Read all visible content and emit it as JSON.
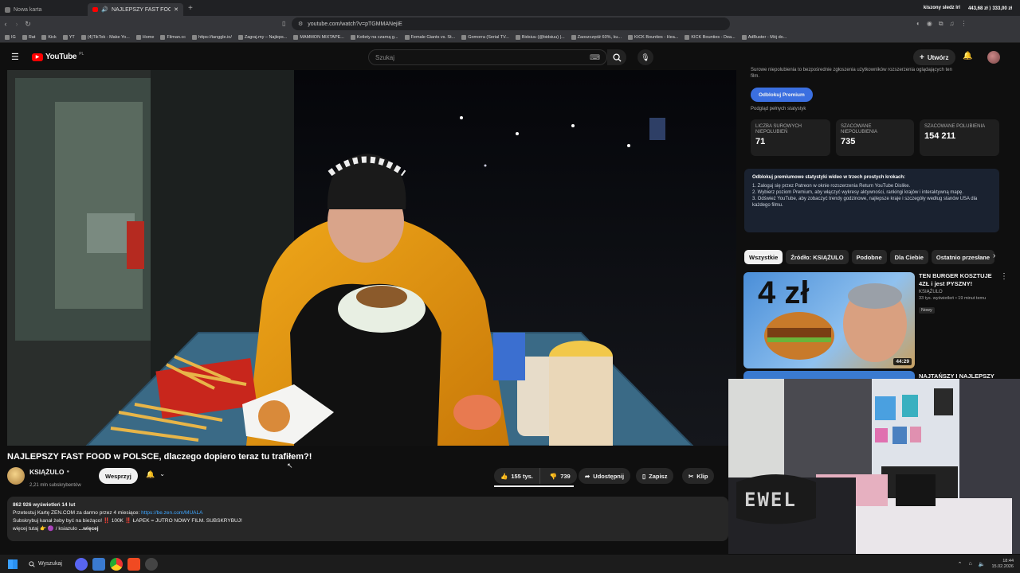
{
  "browser": {
    "tabs": [
      {
        "label": "Nowa karta",
        "active": false
      },
      {
        "label": "NAJLEPSZY FAST FOOD w PO",
        "active": true
      }
    ],
    "url": "youtube.com/watch?v=pTGMMANejiE",
    "top_right": {
      "user": "kiszony sledz lrl",
      "balance": "443,68 zł ⟩ 333,00 zł"
    },
    "bookmarks": [
      "IG",
      "Rat",
      "Kick",
      "YT",
      "(4)TikTok - Make Yo...",
      "Home",
      "Filman.cc",
      "https://tanggle.io/",
      "Zagraj.my – Najleps...",
      "MAMMON MIXTAPE...",
      "Kotlety na czarną g...",
      "Female Giants vs. St...",
      "Gomorra (Serial TV...",
      "Bidsiuu (@bidsiuu) |...",
      "Zaoszczędź 60%, ku...",
      "KICK Bounties - Hea...",
      "KICK Bounties - Dea...",
      "AdBuster - Mój do..."
    ]
  },
  "youtube": {
    "logo": "YouTube",
    "region": "PL",
    "search_placeholder": "Szukaj",
    "create_label": "Utwórz",
    "video": {
      "title": "NAJLEPSZY FAST FOOD w POLSCE, dlaczego dopiero teraz tu trafiłem?!",
      "channel": "KSIĄŻULO",
      "subscribers": "2,21 mln subskrybentów",
      "support_label": "Wesprzyj",
      "likes": "155 tys.",
      "dislikes": "739",
      "share_label": "Udostępnij",
      "save_label": "Zapisz",
      "clip_label": "Klip",
      "views_date": "862 926 wyświetleń  14 lut",
      "desc_line1_prefix": "Przetestuj Kartę ZEN.COM za darmo przez 4 miesiące: ",
      "desc_link": "https://be.zen.com/MUALA",
      "desc_line2": "Subskrybuj kanał żeby być na bieżąco! ‼️ 100K ‼️ ŁAPEK = JUTRO NOWY FILM. SUBSKRYBUJ!",
      "desc_line3": "więcej tutaj 👉 🟣 / ksiazulo",
      "more_label": "...więcej"
    },
    "rydstats": {
      "intro": "Surowe niepolubienia to bezpośrednie zgłoszenia użytkowników rozszerzenia oglądających ten film.",
      "unlock_label": "Odblokuj Premium",
      "full_stats": "Podgląd pełnych statystyk",
      "boxes": [
        {
          "label": "LICZBA SUROWYCH NIEPOLUBIEŃ",
          "value": "71"
        },
        {
          "label": "SZACOWANE NIEPOLUBIENIA",
          "value": "735"
        },
        {
          "label": "SZACOWANE POLUBIENIA",
          "value": "154 211"
        }
      ],
      "premium_title": "Odblokuj premiumowe statystyki wideo w trzech prostych krokach:",
      "steps": [
        "Zaloguj się przez Patreon w oknie rozszerzenia Return YouTube Dislike.",
        "Wybierz poziom Premium, aby włączyć wykresy aktywności, rankingi krajów i interaktywną mapę.",
        "Odśwież YouTube, aby zobaczyć trendy godzinowe, najlepsze kraje i szczegóły według stanów USA dla każdego filmu."
      ]
    },
    "chips": [
      "Wszystkie",
      "Źródło: KSIĄŻULO",
      "Podobne",
      "Dla Ciebie",
      "Ostatnio przesłane"
    ],
    "recommended": [
      {
        "title": "TEN BURGER KOSZTUJE 4ZŁ i jest PYSZNY!",
        "channel": "KSIĄŻULO",
        "meta": "33 tys. wyświetleń • 19 minut temu",
        "badge": "Nowy",
        "duration": "44:29",
        "thumb_text": "4 zł"
      },
      {
        "title": "NAJTAŃSZY I NAJLEPSZY",
        "channel": "",
        "meta": "",
        "badge": "",
        "duration": "",
        "thumb_text": ""
      }
    ]
  },
  "taskbar": {
    "search_label": "Wyszukaj",
    "time": "18:44",
    "date": "15.02.2026"
  },
  "webcam": {
    "sign_text": "EWEL"
  }
}
